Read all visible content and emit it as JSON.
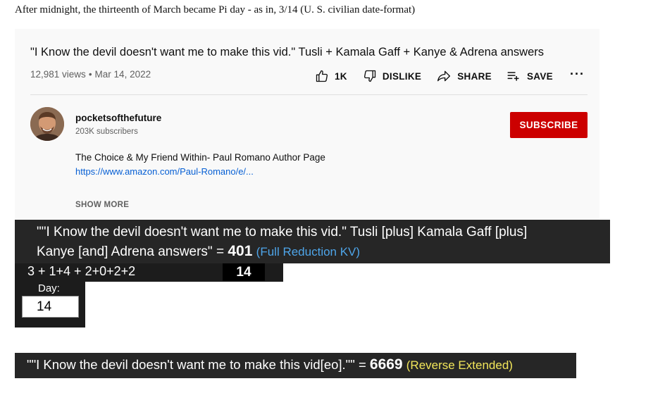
{
  "caption": "After midnight, the thirteenth of March became Pi day - as in, 3/14 (U. S. civilian date-format)",
  "video": {
    "title": "\"I Know the devil doesn't want me to make this vid.\" Tusli + Kamala Gaff + Kanye & Adrena answers",
    "views": "12,981 views",
    "separator": "•",
    "date": "Mar 14, 2022",
    "actions": {
      "like": "1K",
      "dislike": "DISLIKE",
      "share": "SHARE",
      "save": "SAVE",
      "more": "···"
    }
  },
  "channel": {
    "name": "pocketsofthefuture",
    "subscribers": "203K subscribers",
    "subscribe_label": "SUBSCRIBE",
    "brand_color": "#cc0000"
  },
  "description": {
    "line1": "The Choice & My Friend Within- Paul Romano Author Page",
    "link": "https://www.amazon.com/Paul-Romano/e/...",
    "show_more": "SHOW MORE"
  },
  "calc1": {
    "phrase_line1": "\"\"I Know the devil doesn't want me to make this vid.\" Tusli [plus] Kamala Gaff [plus]",
    "phrase_line2": "Kanye [and] Adrena answers\" = ",
    "value": "401",
    "cipher": "(Full Reduction KV)",
    "cipher_color": "#4ea5e9"
  },
  "arithmetic": {
    "expression": "3 + 1+4 + 2+0+2+2",
    "result": "14"
  },
  "day": {
    "label": "Day:",
    "value": "14"
  },
  "calc2": {
    "phrase": "\"\"I Know the devil doesn't want me to make this vid[eo].\"\" = ",
    "value": "6669",
    "cipher": "(Reverse Extended)",
    "cipher_color": "#f2e65a"
  }
}
